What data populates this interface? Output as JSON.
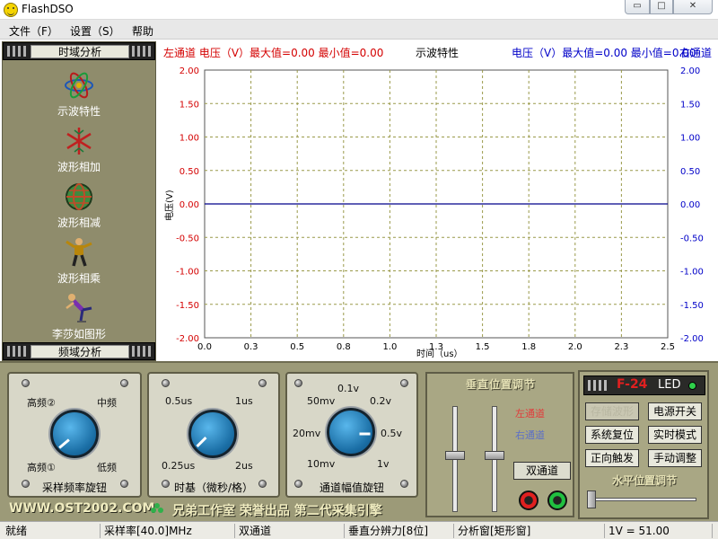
{
  "window": {
    "title": "FlashDSO"
  },
  "menu": [
    "文件（F）",
    "设置（S）",
    "帮助"
  ],
  "sidebar": {
    "time_header": "时域分析",
    "freq_header": "频域分析",
    "items": [
      {
        "label": "示波特性",
        "icon": "atom-icon"
      },
      {
        "label": "波形相加",
        "icon": "snowflake-icon"
      },
      {
        "label": "波形相减",
        "icon": "globe-icon"
      },
      {
        "label": "波形相乘",
        "icon": "figure-icon"
      },
      {
        "label": "李莎如图形",
        "icon": "skater-icon"
      }
    ]
  },
  "scope": {
    "left_header": "左通道 电压（V）最大值=0.00  最小值=0.00",
    "center_title": "示波特性",
    "right_header": "电压（V）最大值=0.00  最小值=0.00",
    "right_channel": "右通道",
    "y_label": "电压(V)",
    "x_label": "时间（us）",
    "colors": {
      "left": "#d40000",
      "right": "#0000c8",
      "trace": "#00008b",
      "grid": "#9a9a4a"
    }
  },
  "chart_data": {
    "type": "line",
    "title": "示波特性",
    "xlabel": "时间（us）",
    "ylabel": "电压(V)",
    "xlim": [
      0.0,
      2.5
    ],
    "ylim": [
      -2.0,
      2.0
    ],
    "x_ticks": [
      "0.0",
      "0.3",
      "0.5",
      "0.8",
      "1.0",
      "1.3",
      "1.5",
      "1.8",
      "2.0",
      "2.3",
      "2.5"
    ],
    "y_ticks_left": [
      "2.00",
      "1.50",
      "1.00",
      "0.50",
      "0.00",
      "-0.50",
      "-1.00",
      "-1.50",
      "-2.00"
    ],
    "y_ticks_right": [
      "2.00",
      "1.50",
      "1.00",
      "0.50",
      "0.00",
      "-0.50",
      "-1.00",
      "-1.50",
      "-2.00"
    ],
    "grid": true,
    "series": [
      {
        "x": [
          0.0,
          2.5
        ],
        "values": [
          0.0,
          0.0
        ]
      }
    ]
  },
  "controls": {
    "freq_knob": {
      "caption": "采样频率旋钮",
      "labels": [
        "高频②",
        "中频",
        "高频①",
        "低频"
      ]
    },
    "timebase_knob": {
      "caption": "时基（微秒/格）",
      "labels": [
        "0.5us",
        "1us",
        "0.25us",
        "2us"
      ]
    },
    "amp_knob": {
      "caption": "通道幅值旋钮",
      "labels": [
        "0.1v",
        "0.2v",
        "50mv",
        "0.5v",
        "20mv",
        "10mv",
        "1v"
      ]
    },
    "vertical_title": "垂直位置调节",
    "left_channel": "左通道",
    "right_channel": "右通道",
    "dual_button": "双通道",
    "f24": {
      "text": "F-24",
      "led": "LED"
    },
    "buttons": [
      "存储波形",
      "电源开关",
      "系统复位",
      "实时模式",
      "正向触发",
      "手动调整"
    ],
    "horizontal_title": "水平位置调节",
    "banner_url": "WWW.OST2002.COM",
    "banner_text": "兄弟工作室 荣誉出品 第二代采集引擎"
  },
  "status": {
    "state": "就绪",
    "sample_rate": "采样率[40.0]MHz",
    "mode": "双通道",
    "v_resolution": "垂直分辨力[8位]",
    "analysis": "分析窗[矩形窗]",
    "scale": "1V = 51.00"
  }
}
